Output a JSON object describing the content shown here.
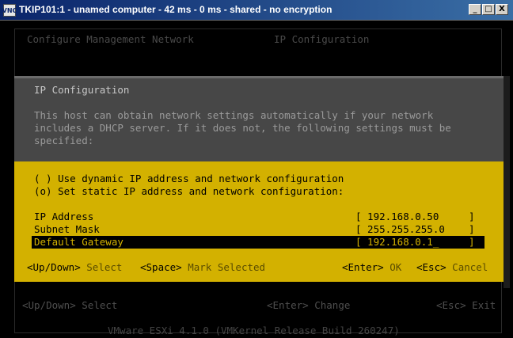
{
  "window": {
    "title": "TKIP101:1 - unamed computer - 42 ms - 0 ms - shared - no encryption",
    "icon_label": "VNC",
    "minimize_glyph": "_",
    "maximize_glyph": "□",
    "close_glyph": "X"
  },
  "background": {
    "header_left": "Configure Management Network",
    "header_right": "IP Configuration",
    "footer": {
      "updown_key": "<Up/Down>",
      "updown_text": "Select",
      "enter_key": "<Enter>",
      "enter_text": "Change",
      "esc_key": "<Esc>",
      "esc_text": "Exit"
    },
    "build_info": "VMware ESXi 4.1.0 (VMKernel Release Build 260247)"
  },
  "dialog": {
    "title": "IP Configuration",
    "description": [
      "This host can obtain network settings automatically if your network",
      "includes a DHCP server. If it does not, the following settings must be",
      "specified:"
    ],
    "options": [
      "( ) Use dynamic IP address and network configuration",
      "(o) Set static IP address and network configuration:"
    ],
    "fields": [
      {
        "label": "IP Address",
        "value": "[ 192.168.0.50     ]"
      },
      {
        "label": "Subnet Mask",
        "value": "[ 255.255.255.0    ]"
      },
      {
        "label": "Default Gateway",
        "value": "[ 192.168.0.1_     ]"
      }
    ],
    "hints": {
      "updown_key": "<Up/Down>",
      "updown_text": "Select",
      "space_key": "<Space>",
      "space_text": "Mark Selected",
      "enter_key": "<Enter>",
      "enter_text": "OK",
      "esc_key": "<Esc>",
      "esc_text": "Cancel"
    }
  },
  "colors": {
    "titlebar_start": "#0a246a",
    "titlebar_end": "#3a6ea5",
    "dialog_yellow": "#d3b100",
    "dialog_gray": "#474747",
    "background": "#000000"
  }
}
